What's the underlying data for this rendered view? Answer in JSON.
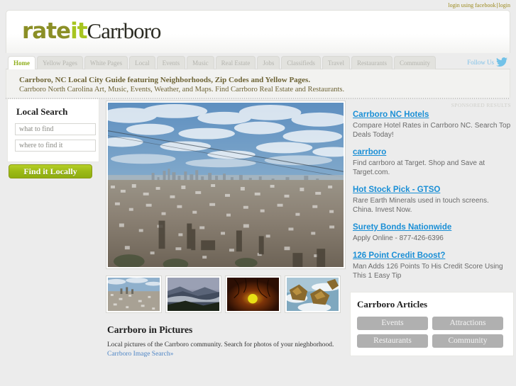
{
  "topbar": {
    "facebook_login": "login using facebook",
    "separator": "|",
    "login": "login"
  },
  "header": {
    "logo_rate": "rate",
    "logo_it": "it",
    "logo_city": "Carrboro"
  },
  "nav": {
    "tabs": [
      {
        "label": "Home",
        "active": true
      },
      {
        "label": "Yellow Pages",
        "active": false
      },
      {
        "label": "White Pages",
        "active": false
      },
      {
        "label": "Local",
        "active": false
      },
      {
        "label": "Events",
        "active": false
      },
      {
        "label": "Music",
        "active": false
      },
      {
        "label": "Real Estate",
        "active": false
      },
      {
        "label": "Jobs",
        "active": false
      },
      {
        "label": "Classifieds",
        "active": false
      },
      {
        "label": "Travel",
        "active": false
      },
      {
        "label": "Restaurants",
        "active": false
      },
      {
        "label": "Community",
        "active": false
      }
    ],
    "follow_label": "Follow Us",
    "follow_icon": "twitter-bird-icon"
  },
  "tagline": {
    "line1": "Carrboro, NC Local City Guide featuring Neighborhoods, Zip Codes and Yellow Pages.",
    "line2": "Carrboro North Carolina Art, Music, Events, Weather, and Maps. Find Carrboro Real Estate and Restaurants."
  },
  "local_search": {
    "title": "Local Search",
    "what_placeholder": "what to find",
    "what_value": "",
    "where_placeholder": "where to find it",
    "where_value": "",
    "button_label": "Find it Locally"
  },
  "pictures": {
    "hero_alt": "carrboro-aerial-cityscape-photo",
    "thumbs": [
      {
        "alt": "cityscape-thumbnail"
      },
      {
        "alt": "misty-mountains-thumbnail"
      },
      {
        "alt": "sunset-branches-thumbnail"
      },
      {
        "alt": "rocky-coastline-thumbnail"
      }
    ],
    "title": "Carrboro in Pictures",
    "body": "Local pictures of the Carrboro community. Search for photos of your nieghborhood. ",
    "link": "Carrboro Image Search»"
  },
  "sponsored": {
    "label": "SPONSORED RESULTS",
    "ads": [
      {
        "title": "Carrboro NC Hotels",
        "desc": "Compare Hotel Rates in Carrboro NC. Search Top Deals Today!"
      },
      {
        "title": "carrboro",
        "desc": "Find carrboro at Target. Shop and Save at Target.com."
      },
      {
        "title": "Hot Stock Pick - GTSO",
        "desc": "Rare Earth Minerals used in touch screens. China. Invest Now."
      },
      {
        "title": "Surety Bonds Nationwide",
        "desc": "Apply Online - 877-426-6396"
      },
      {
        "title": "126 Point Credit Boost?",
        "desc": "Man Adds 126 Points To His Credit Score Using This 1 Easy Tip"
      }
    ]
  },
  "articles": {
    "title": "Carrboro Articles",
    "buttons": [
      {
        "label": "Events"
      },
      {
        "label": "Attractions"
      },
      {
        "label": "Restaurants"
      },
      {
        "label": "Community"
      }
    ]
  },
  "colors": {
    "accent_green": "#9cba16",
    "logo_olive": "#8b8f26",
    "logo_lime": "#a7c520",
    "link_blue": "#1a8fd6",
    "tagline_brown": "#6d6335",
    "page_bg": "#ececec"
  }
}
